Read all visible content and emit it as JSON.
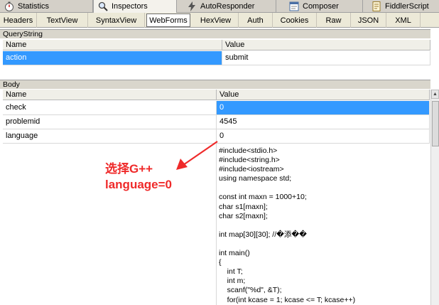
{
  "top_tabs": [
    {
      "label": "Statistics",
      "icon": "stopwatch-icon"
    },
    {
      "label": "Inspectors",
      "icon": "magnifier-icon",
      "active": true
    },
    {
      "label": "AutoResponder",
      "icon": "lightning-icon"
    },
    {
      "label": "Composer",
      "icon": "composer-icon"
    },
    {
      "label": "FiddlerScript",
      "icon": "script-icon"
    }
  ],
  "sub_tabs": [
    "Headers",
    "TextView",
    "SyntaxView",
    "WebForms",
    "HexView",
    "Auth",
    "Cookies",
    "Raw",
    "JSON",
    "XML"
  ],
  "sub_tab_active": "WebForms",
  "querystring": {
    "title": "QueryString",
    "col_name": "Name",
    "col_value": "Value",
    "rows": [
      {
        "name": "action",
        "value": "submit"
      }
    ]
  },
  "body": {
    "title": "Body",
    "col_name": "Name",
    "col_value": "Value",
    "rows": [
      {
        "name": "check",
        "value": "0"
      },
      {
        "name": "problemid",
        "value": "4545"
      },
      {
        "name": "language",
        "value": "0"
      }
    ],
    "code_lines": [
      "#include<stdio.h>",
      "#include<string.h>",
      "#include<iostream>",
      "using namespace std;",
      "",
      "const int maxn = 1000+10;",
      "char s1[maxn];",
      "char s2[maxn];",
      "",
      "int map[30][30]; //�添��",
      "",
      "int main()",
      "{",
      "    int T;",
      "    int m;",
      "    scanf(\"%d\", &T);",
      "    for(int kcase = 1; kcase <= T; kcase++)",
      "    {"
    ]
  },
  "annotation": {
    "line1": "选择G++",
    "line2": "language=0",
    "color": "#ef2a2a"
  },
  "colors": {
    "selection": "#3399ff",
    "toolbar": "#d4d0c8"
  }
}
